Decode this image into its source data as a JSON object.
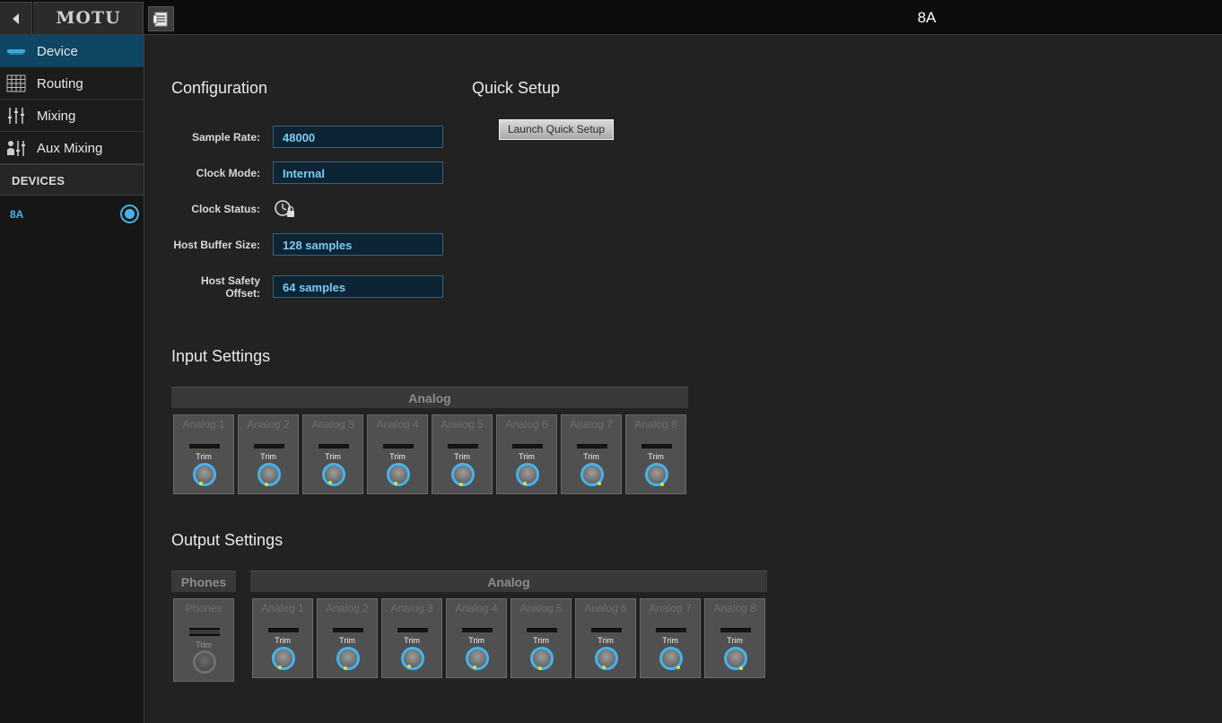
{
  "app": {
    "logo": "MOTU",
    "device_title": "8A"
  },
  "sidebar": {
    "items": [
      {
        "label": "Device",
        "icon": "device-icon",
        "active": true
      },
      {
        "label": "Routing",
        "icon": "routing-grid-icon",
        "active": false
      },
      {
        "label": "Mixing",
        "icon": "mixing-faders-icon",
        "active": false
      },
      {
        "label": "Aux Mixing",
        "icon": "aux-mixing-icon",
        "active": false
      }
    ],
    "devices_header": "DEVICES",
    "devices": [
      {
        "label": "8A",
        "selected": true
      }
    ]
  },
  "configuration": {
    "title": "Configuration",
    "sample_rate_label": "Sample Rate:",
    "sample_rate": "48000",
    "clock_mode_label": "Clock Mode:",
    "clock_mode": "Internal",
    "clock_status_label": "Clock Status:",
    "clock_status_icon": "clock-locked-icon",
    "host_buffer_label": "Host Buffer Size:",
    "host_buffer": "128 samples",
    "host_safety_label_line1": "Host Safety",
    "host_safety_label_line2": "Offset:",
    "host_safety": "64 samples"
  },
  "quick_setup": {
    "title": "Quick Setup",
    "button_label": "Launch Quick Setup"
  },
  "input_settings": {
    "title": "Input Settings",
    "group_label": "Analog",
    "trim_label": "Trim",
    "channels": [
      "Analog 1",
      "Analog 2",
      "Analog 3",
      "Analog 4",
      "Analog 5",
      "Analog 6",
      "Analog 7",
      "Analog 8"
    ]
  },
  "output_settings": {
    "title": "Output Settings",
    "phones_group_label": "Phones",
    "phones_channel": "Phones",
    "analog_group_label": "Analog",
    "trim_label": "Trim",
    "channels": [
      "Analog 1",
      "Analog 2",
      "Analog 3",
      "Analog 4",
      "Analog 5",
      "Analog 6",
      "Analog 7",
      "Analog 8"
    ]
  },
  "colors": {
    "accent": "#45b3ee",
    "active_nav": "#0e4663",
    "value_text": "#7dcaf3",
    "knob_indicator": "#d8e33a"
  }
}
